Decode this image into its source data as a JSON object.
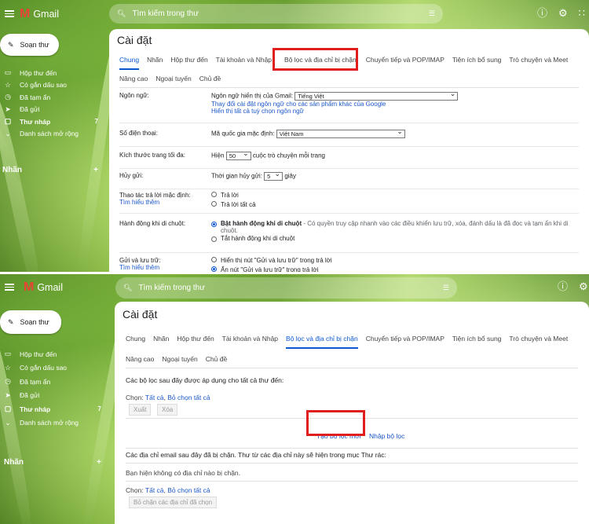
{
  "app": {
    "name": "Gmail"
  },
  "header": {
    "search_placeholder": "Tìm kiếm trong thư",
    "filter_icon": "tune-icon",
    "help_icon": "help-icon",
    "settings_icon": "gear-icon",
    "apps_icon": "apps-grid-icon"
  },
  "sidebar": {
    "compose_label": "Soạn thư",
    "items": [
      {
        "label": "Hộp thư đến",
        "icon": "inbox-icon"
      },
      {
        "label": "Có gắn dấu sao",
        "icon": "star-icon"
      },
      {
        "label": "Đã tạm ẩn",
        "icon": "clock-icon"
      },
      {
        "label": "Đã gửi",
        "icon": "send-icon"
      },
      {
        "label": "Thư nháp",
        "icon": "draft-icon",
        "count": "7"
      },
      {
        "label": "Danh sách mở rộng",
        "icon": "chevron-down-icon"
      }
    ],
    "labels_title": "Nhãn",
    "add_label": "+"
  },
  "settings": {
    "title": "Cài đặt",
    "tabs": [
      "Chung",
      "Nhãn",
      "Hộp thư đến",
      "Tài khoản và Nhập",
      "Bộ lọc và địa chỉ bị chặn",
      "Chuyển tiếp và POP/IMAP",
      "Tiện ích bổ sung",
      "Trò chuyện và Meet"
    ],
    "tabs_row2": [
      "Nâng cao",
      "Ngoại tuyến",
      "Chủ đề"
    ]
  },
  "general": {
    "language": {
      "label": "Ngôn ngữ:",
      "display_label": "Ngôn ngữ hiển thị của Gmail:",
      "display_value": "Tiếng Việt",
      "link1": "Thay đổi cài đặt ngôn ngữ cho các sản phẩm khác của Google",
      "link2": "Hiển thị tất cả tuỳ chọn ngôn ngữ"
    },
    "phone": {
      "label": "Số điện thoại:",
      "country_label": "Mã quốc gia mặc định:",
      "country_value": "Việt Nam"
    },
    "page_size": {
      "label": "Kích thước trang tối đa:",
      "prefix": "Hiện",
      "value": "50",
      "suffix": "cuộc trò chuyện mỗi trang"
    },
    "undo": {
      "label": "Hủy gửi:",
      "prefix": "Thời gian hủy gửi:",
      "value": "5",
      "suffix": "giây"
    },
    "reply": {
      "label": "Thao tác trả lời mặc định:",
      "learn_more": "Tìm hiểu thêm",
      "opt1": "Trả lời",
      "opt2": "Trả lời tất cả"
    },
    "hover": {
      "label": "Hành động khi di chuột:",
      "opt1_bold": "Bật hành động khi di chuột",
      "opt1_desc": " - Có quyền truy cập nhanh vào các điều khiển lưu trữ, xóa, đánh dấu là đã đọc và tạm ẩn khi di chuột.",
      "opt2": "Tắt hành động khi di chuột"
    },
    "send_archive": {
      "label": "Gửi và lưu trữ:",
      "learn_more": "Tìm hiểu thêm",
      "opt1": "Hiển thị nút \"Gửi và lưu trữ\" trong trả lời",
      "opt2": "Ẩn nút \"Gửi và lưu trữ\" trong trả lời"
    }
  },
  "filters": {
    "filters_heading": "Các bộ lọc sau đây được áp dụng cho tất cả thư đến:",
    "select_prefix": "Chọn:",
    "select_all": "Tất cả",
    "select_none": "Bỏ chọn tất cả",
    "export_btn": "Xuất",
    "delete_btn": "Xóa",
    "create_filter": "Tạo bộ lọc mới",
    "import_filter": "Nhập bộ lọc",
    "blocked_heading": "Các địa chỉ email sau đây đã bị chặn. Thư từ các địa chỉ này sẽ hiện trong mục Thư rác:",
    "no_blocked": "Bạn hiện không có địa chỉ nào bị chặn.",
    "unblock_btn": "Bỏ chặn các địa chỉ đã chọn"
  },
  "colors": {
    "accent": "#0b57d0",
    "highlight": "#e01e1e"
  }
}
